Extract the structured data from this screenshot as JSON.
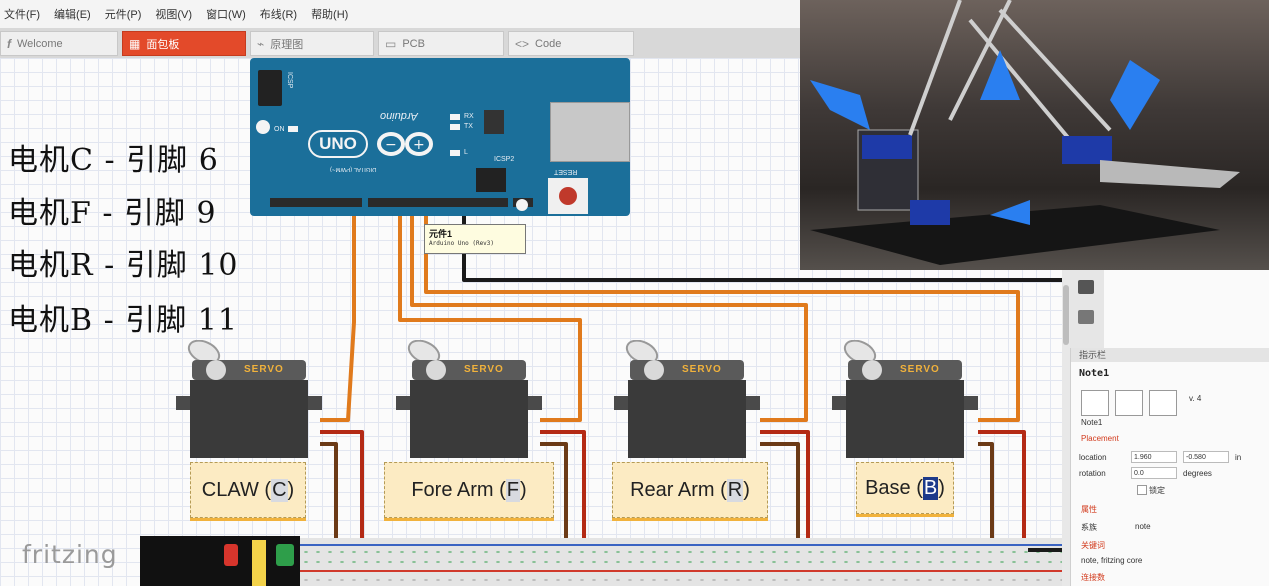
{
  "menu": [
    "文件(F)",
    "编辑(E)",
    "元件(P)",
    "视图(V)",
    "窗口(W)",
    "布线(R)",
    "帮助(H)"
  ],
  "tabs": [
    {
      "label": "Welcome",
      "icon": "fritzing-logo-icon"
    },
    {
      "label": "面包板",
      "icon": "breadboard-icon",
      "active": true
    },
    {
      "label": "原理图",
      "icon": "schematic-icon"
    },
    {
      "label": "PCB",
      "icon": "pcb-icon"
    },
    {
      "label": "Code",
      "icon": "code-icon"
    }
  ],
  "arduino": {
    "logo": "UNO",
    "brand": "Arduino",
    "icsp": "ICSP",
    "icsp2": "ICSP2",
    "reset": "RESET",
    "on": "ON",
    "tx": "TX",
    "rx": "RX",
    "l": "L",
    "digital": "DIGITAL (PWM~)"
  },
  "tooltip": {
    "title": "元件1",
    "subtitle": "Arduino Uno (Rev3)"
  },
  "motor_labels": [
    "电机C - 引脚 6",
    "电机F - 引脚 9",
    "电机R - 引脚 10",
    "电机B - 引脚 11"
  ],
  "servos": [
    {
      "label": "SERVO",
      "note_prefix": "CLAW (",
      "note_key": "C",
      "note_suffix": ")"
    },
    {
      "label": "SERVO",
      "note_prefix": "Fore Arm (",
      "note_key": "F",
      "note_suffix": ")"
    },
    {
      "label": "SERVO",
      "note_prefix": "Rear Arm (",
      "note_key": "R",
      "note_suffix": ")"
    },
    {
      "label": "SERVO",
      "note_prefix": "Base (",
      "note_key": "B",
      "note_suffix": ")"
    }
  ],
  "inspector": {
    "header": "指示栏",
    "title": "Note1",
    "version": "v. 4",
    "item_name": "Note1",
    "placement": "Placement",
    "location_label": "location",
    "location_x": "1.960",
    "location_y": "-0.580",
    "location_unit": "in",
    "rotation_label": "rotation",
    "rotation_value": "0.0",
    "rotation_unit": "degrees",
    "lock": "锁定",
    "props_header": "属性",
    "family_label": "系族",
    "family_value": "note",
    "tags_header": "关键词",
    "tags_value": "note, fritzing core",
    "connections_header": "连接数"
  },
  "bottom": {
    "brand": "fritzing"
  },
  "colors": {
    "accent": "#e34a2a",
    "board": "#1b6f9a",
    "wire_orange": "#e07a1c",
    "wire_red": "#b42a15",
    "wire_brown": "#6b3a16"
  }
}
